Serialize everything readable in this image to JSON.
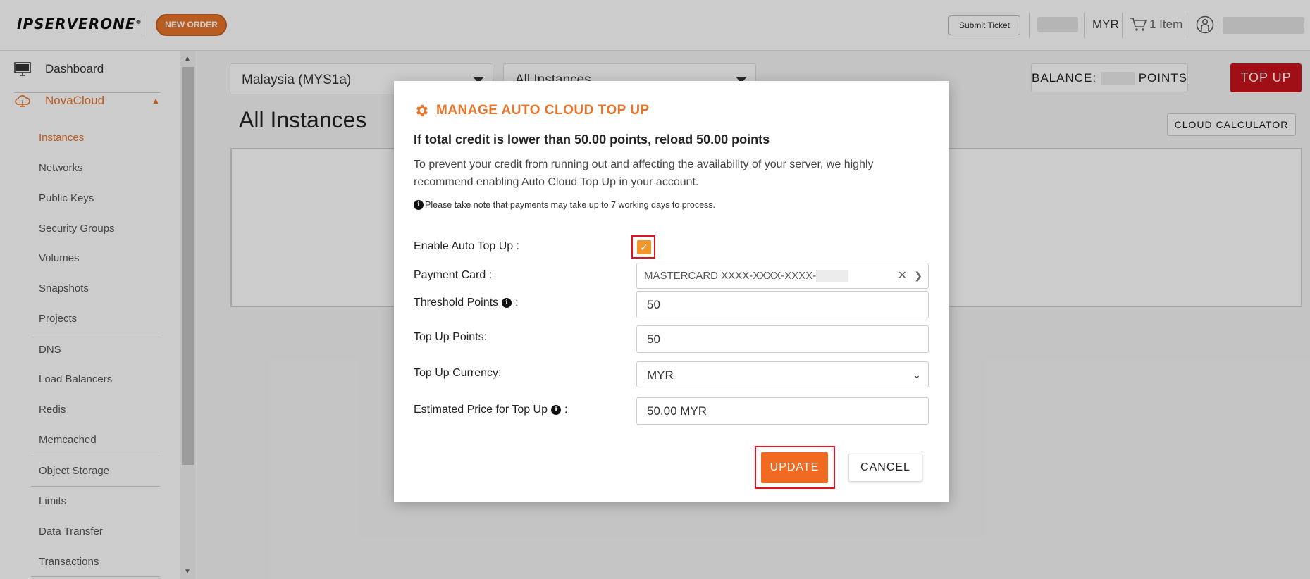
{
  "topbar": {
    "logo_text": "IPSERVERONE",
    "new_order": "NEW ORDER",
    "submit_ticket": "Submit Ticket",
    "currency": "MYR",
    "cart_label": "1 Item"
  },
  "sidebar": {
    "dashboard": "Dashboard",
    "novacloud": "NovaCloud",
    "items": [
      "Instances",
      "Networks",
      "Public Keys",
      "Security Groups",
      "Volumes",
      "Snapshots",
      "Projects",
      "DNS",
      "Load Balancers",
      "Redis",
      "Memcached",
      "Object Storage",
      "Limits",
      "Data Transfer",
      "Transactions"
    ]
  },
  "main": {
    "region_select": "Malaysia (MYS1a)",
    "instance_filter": "All Instances",
    "balance_label": "BALANCE:",
    "balance_unit": "POINTS",
    "topup_button": "TOP UP",
    "page_title": "All Instances",
    "calculator_button": "CLOUD CALCULATOR"
  },
  "modal": {
    "title": "MANAGE AUTO CLOUD TOP UP",
    "heading": "If total credit is lower than 50.00 points, reload 50.00 points",
    "description": "To prevent your credit from running out and affecting the availability of your server, we highly recommend enabling Auto Cloud Top Up in your account.",
    "note": "Please take note that payments may take up to 7 working days to process.",
    "labels": {
      "enable": "Enable Auto Top Up :",
      "payment_card": "Payment Card :",
      "threshold": "Threshold Points",
      "threshold_suffix": ":",
      "topup_points": "Top Up Points:",
      "topup_currency": "Top Up Currency:",
      "estimated_price": "Estimated Price for Top Up",
      "estimated_suffix": ":"
    },
    "values": {
      "enabled": true,
      "payment_card": "MASTERCARD XXXX-XXXX-XXXX-",
      "threshold": "50",
      "topup_points": "50",
      "topup_currency": "MYR",
      "estimated_price": "50.00 MYR"
    },
    "update_button": "UPDATE",
    "cancel_button": "CANCEL"
  },
  "colors": {
    "accent": "#e8742a",
    "topup_red": "#c8131b",
    "highlight_red": "#e0141e",
    "checkbox": "#f0962d"
  }
}
